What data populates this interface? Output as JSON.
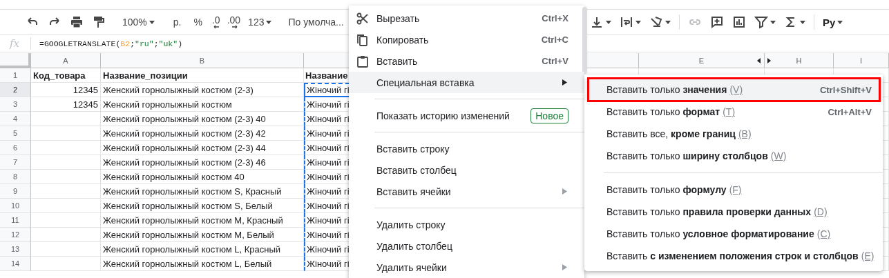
{
  "toolbar": {
    "zoom": "100%",
    "currency": "р.",
    "percent": "%",
    "decrease_decimals": ".0",
    "increase_decimals": ".00",
    "number_format": "123",
    "font": "По умолча...",
    "input_tools": "Ру"
  },
  "formula_bar": {
    "label": "fx",
    "parts": [
      {
        "kind": "plain",
        "text": "=GOOGLETRANSLATE("
      },
      {
        "kind": "ref",
        "text": "B2"
      },
      {
        "kind": "plain",
        "text": ";"
      },
      {
        "kind": "string",
        "text": "\"ru\""
      },
      {
        "kind": "plain",
        "text": ";"
      },
      {
        "kind": "string",
        "text": "\"uk\""
      },
      {
        "kind": "plain",
        "text": ")"
      }
    ]
  },
  "grid": {
    "columns": [
      {
        "label": "A"
      },
      {
        "label": "B"
      },
      {
        "copied": true
      },
      {
        "label": "E"
      },
      {
        "label": "H",
        "hidden_before": true
      },
      {
        "label": "I"
      }
    ],
    "rows": [
      {
        "number": "1",
        "kind": "heading",
        "selected": false,
        "active": false,
        "cells": [
          "Код_товара",
          "Название_позиции",
          "Название"
        ]
      },
      {
        "number": "2",
        "kind": "data",
        "selected": true,
        "active": true,
        "cells": [
          "12345",
          "Женский горнолыжный костюм (2-3)",
          "Жіночий гі"
        ]
      },
      {
        "number": "3",
        "kind": "data",
        "selected": false,
        "active": false,
        "cells": [
          "12345",
          "Женский горнолыжный костюм",
          "Жіночий гі"
        ]
      },
      {
        "number": "4",
        "kind": "data",
        "selected": false,
        "active": false,
        "cells": [
          "",
          "Женский горнолыжный костюм (2-3) 40",
          "Жіночий гі"
        ]
      },
      {
        "number": "5",
        "kind": "data",
        "selected": false,
        "active": false,
        "cells": [
          "",
          "Женский горнолыжный костюм (2-3) 42",
          "Жіночий гі"
        ]
      },
      {
        "number": "6",
        "kind": "data",
        "selected": false,
        "active": false,
        "cells": [
          "",
          "Женский горнолыжный костюм (2-3) 44",
          "Жіночий гі"
        ]
      },
      {
        "number": "7",
        "kind": "data",
        "selected": false,
        "active": false,
        "cells": [
          "",
          "Женский горнолыжный костюм (2-3) 46",
          "Жіночий гі"
        ]
      },
      {
        "number": "8",
        "kind": "data",
        "selected": false,
        "active": false,
        "cells": [
          "",
          "Женский горнолыжный костюм 40",
          "Жіночий гі"
        ]
      },
      {
        "number": "9",
        "kind": "data",
        "selected": false,
        "active": false,
        "cells": [
          "",
          "Женский горнолыжный костюм S, Красный",
          "Жіночий гі"
        ]
      },
      {
        "number": "10",
        "kind": "data",
        "selected": false,
        "active": false,
        "cells": [
          "",
          "Женский горнолыжный костюм S, Белый",
          "Жіночий гі"
        ]
      },
      {
        "number": "11",
        "kind": "data",
        "selected": false,
        "active": false,
        "cells": [
          "",
          "Женский горнолыжный костюм M, Красный",
          "Жіночий гі"
        ]
      },
      {
        "number": "12",
        "kind": "data",
        "selected": false,
        "active": false,
        "cells": [
          "",
          "Женский горнолыжный костюм M, Белый",
          "Жіночий гі"
        ]
      },
      {
        "number": "13",
        "kind": "data",
        "selected": false,
        "active": false,
        "cells": [
          "",
          "Женский горнолыжный костюм L, Красный",
          "Жіночий гі"
        ]
      },
      {
        "number": "14",
        "kind": "data",
        "selected": false,
        "active": false,
        "cells": [
          "",
          "Женский горнолыжный костюм L, Белый",
          "Жіночий гі"
        ]
      }
    ]
  },
  "context_menu": {
    "items": [
      {
        "kind": "item",
        "label": "Вырезать",
        "shortcut": "Ctrl+X",
        "selected": false
      },
      {
        "kind": "item",
        "label": "Копировать",
        "shortcut": "Ctrl+C",
        "selected": false
      },
      {
        "kind": "item",
        "label": "Вставить",
        "shortcut": "Ctrl+V",
        "selected": false
      },
      {
        "kind": "item",
        "label": "Специальная вставка",
        "submenu": true,
        "selected": true
      },
      {
        "kind": "divider"
      },
      {
        "kind": "item",
        "label": "Показать историю изменений",
        "badge": "Новое",
        "selected": false
      },
      {
        "kind": "divider"
      },
      {
        "kind": "item",
        "label": "Вставить строку",
        "selected": false
      },
      {
        "kind": "item",
        "label": "Вставить столбец",
        "selected": false
      },
      {
        "kind": "item",
        "label": "Вставить ячейки",
        "submenu": true,
        "selected": false
      },
      {
        "kind": "divider"
      },
      {
        "kind": "item",
        "label": "Удалить строку",
        "selected": false
      },
      {
        "kind": "item",
        "label": "Удалить столбец",
        "selected": false
      },
      {
        "kind": "item",
        "label": "Удалить ячейки",
        "submenu": true,
        "selected": false
      }
    ]
  },
  "submenu": {
    "items": [
      {
        "kind": "item",
        "label": "Вставить только **значения**",
        "hotkey": "(V)",
        "shortcut": "Ctrl+Shift+V",
        "selected": true,
        "outlined": true
      },
      {
        "kind": "item",
        "label": "Вставить только **формат**",
        "hotkey": "(T)",
        "shortcut": "Ctrl+Alt+V",
        "selected": false,
        "outlined": false
      },
      {
        "kind": "item",
        "label": "Вставить все, **кроме границ**",
        "hotkey": "(B)",
        "selected": false,
        "outlined": false
      },
      {
        "kind": "item",
        "label": "Вставить только **ширину столбцов**",
        "hotkey": "(W)",
        "selected": false,
        "outlined": false
      },
      {
        "kind": "divider"
      },
      {
        "kind": "item",
        "label": "Вставить только **формулу**",
        "hotkey": "(F)",
        "selected": false,
        "outlined": false
      },
      {
        "kind": "item",
        "label": "Вставить только **правила проверки данных**",
        "hotkey": "(D)",
        "selected": false,
        "outlined": false
      },
      {
        "kind": "item",
        "label": "Вставить только **условное форматирование**",
        "hotkey": "(C)",
        "selected": false,
        "outlined": false
      },
      {
        "kind": "item",
        "label": "Вставить **с изменением положения строк и столбцов**",
        "hotkey": "(E)",
        "selected": false,
        "outlined": false
      }
    ]
  }
}
